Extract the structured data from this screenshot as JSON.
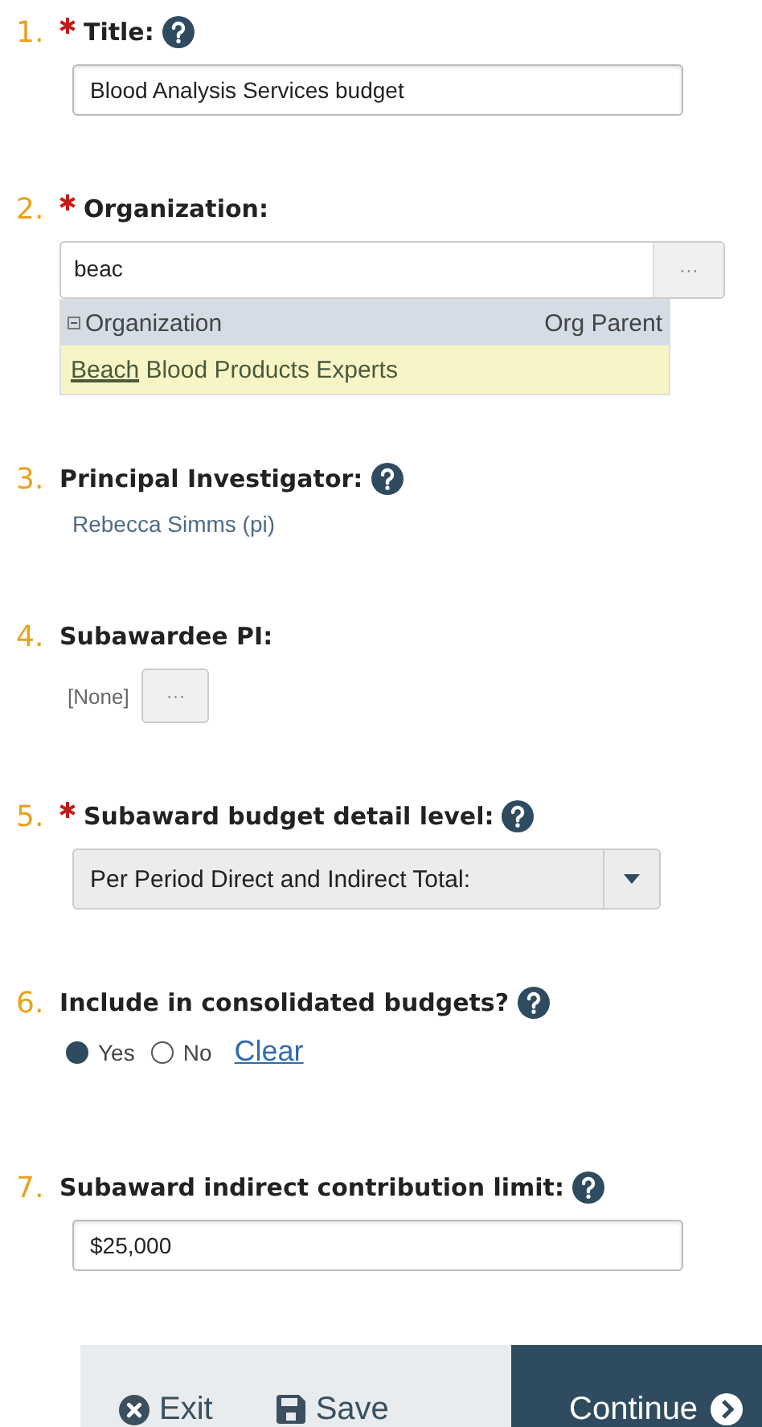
{
  "questions": [
    {
      "kind": "text",
      "number": "1.",
      "required": true,
      "label": "Title:",
      "help": true,
      "value": "Blood Analysis Services budget"
    },
    {
      "kind": "lookup",
      "number": "2.",
      "required": true,
      "label": "Organization:",
      "help": false,
      "value": "beac",
      "button": "···",
      "columns": [
        "Organization",
        "Org Parent"
      ],
      "suggestions": [
        {
          "match": "Beach",
          "rest": " Blood Products Experts",
          "selected": true
        }
      ]
    },
    {
      "kind": "readonly",
      "number": "3.",
      "required": false,
      "label": "Principal Investigator:",
      "help": true,
      "value": "Rebecca Simms (pi)"
    },
    {
      "kind": "chooser",
      "number": "4.",
      "required": false,
      "label": "Subawardee PI:",
      "help": false,
      "value": "[None]",
      "button": "···"
    },
    {
      "kind": "select",
      "number": "5.",
      "required": true,
      "label": "Subaward budget detail level:",
      "help": true,
      "value": "Per Period Direct and Indirect Total:"
    },
    {
      "kind": "radio",
      "number": "6.",
      "required": false,
      "label": "Include in consolidated budgets?",
      "help": true,
      "options": [
        {
          "label": "Yes",
          "selected": true
        },
        {
          "label": "No",
          "selected": false
        }
      ],
      "clear": "Clear"
    },
    {
      "kind": "text",
      "number": "7.",
      "required": false,
      "label": "Subaward indirect contribution limit:",
      "help": true,
      "value": "$25,000"
    }
  ],
  "footer": {
    "buttons": [
      {
        "kind": "exit",
        "label": "Exit"
      },
      {
        "kind": "save",
        "label": "Save"
      },
      {
        "kind": "continue",
        "label": "Continue"
      }
    ]
  }
}
